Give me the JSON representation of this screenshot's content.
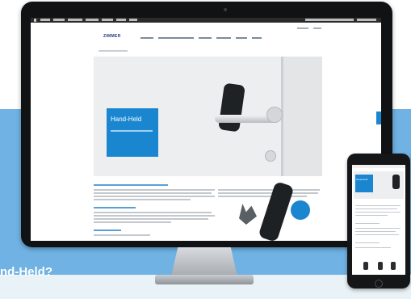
{
  "site": {
    "logo": "ZIMMER",
    "hero_title": "Hand-Held",
    "phone_title": "Hand-Held"
  },
  "overlay": {
    "question": "nd-Held?"
  },
  "colors": {
    "background_blue": "#6fb2e3",
    "brand_blue": "#1a86d0",
    "logo_blue": "#1d3b7e",
    "device_black": "#101214"
  }
}
